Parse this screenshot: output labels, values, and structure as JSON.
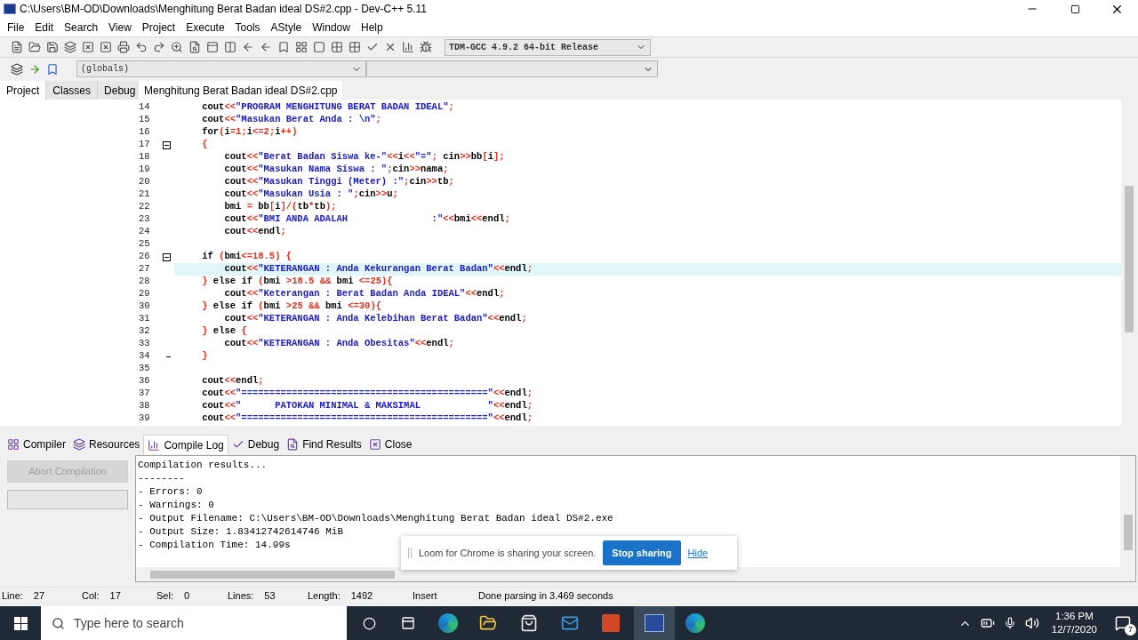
{
  "window": {
    "title": "C:\\Users\\BM-OD\\Downloads\\Menghitung Berat Badan ideal DS#2.cpp - Dev-C++ 5.11"
  },
  "menu": [
    "File",
    "Edit",
    "Search",
    "View",
    "Project",
    "Execute",
    "Tools",
    "AStyle",
    "Window",
    "Help"
  ],
  "compiler_select": {
    "value": "TDM-GCC 4.9.2 64-bit Release"
  },
  "scope_select": {
    "value": "(globals)"
  },
  "side_tabs": [
    {
      "label": "Project",
      "selected": true
    },
    {
      "label": "Classes",
      "selected": false
    },
    {
      "label": "Debug",
      "selected": false
    }
  ],
  "editor_tabs": [
    {
      "label": "Menghitung Berat Badan ideal DS#2.cpp",
      "selected": true
    }
  ],
  "editor": {
    "lines": [
      {
        "number": "14",
        "kind": "plain",
        "text": "    cout<<\"PROGRAM MENGHITUNG BERAT BADAN IDEAL\";",
        "current": false
      },
      {
        "number": "15",
        "kind": "plain",
        "text": "    cout<<\"Masukan Berat Anda : \\n\";",
        "current": false
      },
      {
        "number": "16",
        "kind": "plain",
        "text": "    for(i=1;i<=2;i++)",
        "current": false
      },
      {
        "number": "17",
        "kind": "fold_start",
        "text": "    {",
        "current": false
      },
      {
        "number": "18",
        "kind": "plain",
        "text": "        cout<<\"Berat Badan Siswa ke-\"<<i<<\"=\"; cin>>bb[i];",
        "current": false
      },
      {
        "number": "19",
        "kind": "plain",
        "text": "        cout<<\"Masukan Nama Siswa : \";cin>>nama;",
        "current": false
      },
      {
        "number": "20",
        "kind": "plain",
        "text": "        cout<<\"Masukan Tinggi (Meter) :\";cin>>tb;",
        "current": false
      },
      {
        "number": "21",
        "kind": "plain",
        "text": "        cout<<\"Masukan Usia : \";cin>>u;",
        "current": false
      },
      {
        "number": "22",
        "kind": "plain",
        "text": "        bmi = bb[i]/(tb*tb);",
        "current": false
      },
      {
        "number": "23",
        "kind": "plain",
        "text": "        cout<<\"BMI ANDA ADALAH               :\"<<bmi<<endl;",
        "current": false
      },
      {
        "number": "24",
        "kind": "plain",
        "text": "        cout<<endl;",
        "current": false
      },
      {
        "number": "25",
        "kind": "plain",
        "current": false
      },
      {
        "number": "26",
        "kind": "fold_start",
        "text": "    if (bmi<=18.5) {",
        "current": false
      },
      {
        "number": "27",
        "kind": "plain",
        "text": "        cout<<\"KETERANGAN : Anda Kekurangan Berat Badan\"<<endl;",
        "current": true
      },
      {
        "number": "28",
        "kind": "plain",
        "text": "    } else if (bmi >18.5 && bmi <=25){",
        "current": false
      },
      {
        "number": "29",
        "kind": "plain",
        "text": "        cout<<\"Keterangan : Berat Badan Anda IDEAL\"<<endl;",
        "current": false
      },
      {
        "number": "30",
        "kind": "plain",
        "text": "    } else if (bmi >25 && bmi <=30){",
        "current": false
      },
      {
        "number": "31",
        "kind": "plain",
        "text": "        cout<<\"KETERANGAN : Anda Kelebihan Berat Badan\"<<endl;",
        "current": false
      },
      {
        "number": "32",
        "kind": "plain",
        "text": "    } else {",
        "current": false
      },
      {
        "number": "33",
        "kind": "plain",
        "text": "        cout<<\"KETERANGAN : Anda Obesitas\"<<endl;",
        "current": false
      },
      {
        "number": "34",
        "kind": "fold_end",
        "text": "    }",
        "current": false
      },
      {
        "number": "35",
        "kind": "plain",
        "current": false
      },
      {
        "number": "36",
        "kind": "plain",
        "text": "    cout<<endl;",
        "current": false
      },
      {
        "number": "37",
        "kind": "plain",
        "text": "    cout<<\"============================================\"<<endl;",
        "current": false
      },
      {
        "number": "38",
        "kind": "plain",
        "text": "    cout<<\"      PATOKAN MINIMAL & MAKSIMAL            \"<<endl;",
        "current": false
      },
      {
        "number": "39",
        "kind": "plain",
        "text": "    cout<<\"============================================\"<<endl;",
        "current": false
      }
    ]
  },
  "bottom_tabs": [
    {
      "label": "Compiler",
      "selected": false
    },
    {
      "label": "Resources",
      "selected": false
    },
    {
      "label": "Compile Log",
      "selected": true
    },
    {
      "label": "Debug",
      "selected": false
    },
    {
      "label": "Find Results",
      "selected": false
    },
    {
      "label": "Close",
      "selected": false
    }
  ],
  "abort_button": {
    "label": "Abort Compilation",
    "disabled": true
  },
  "log": [
    "Compilation results...",
    "--------",
    "- Errors: 0",
    "- Warnings: 0",
    "- Output Filename: C:\\Users\\BM-OD\\Downloads\\Menghitung Berat Badan ideal DS#2.exe",
    "- Output Size: 1.83412742614746 MiB",
    "- Compilation Time: 14.99s"
  ],
  "notification": {
    "text": "Loom for Chrome is sharing your screen.",
    "button": "Stop sharing",
    "link": "Hide"
  },
  "status_bar": [
    {
      "label": "Line:",
      "value": "27"
    },
    {
      "label": "Col:",
      "value": "17"
    },
    {
      "label": "Sel:",
      "value": "0"
    },
    {
      "label": "Lines:",
      "value": "53"
    },
    {
      "label": "Length:",
      "value": "1492"
    }
  ],
  "status_mode": "Insert",
  "status_message": "Done parsing in 3.469 seconds",
  "taskbar": {
    "search_placeholder": "Type here to search",
    "time": "1:36 PM",
    "date": "12/7/2020",
    "notifications": "7"
  }
}
